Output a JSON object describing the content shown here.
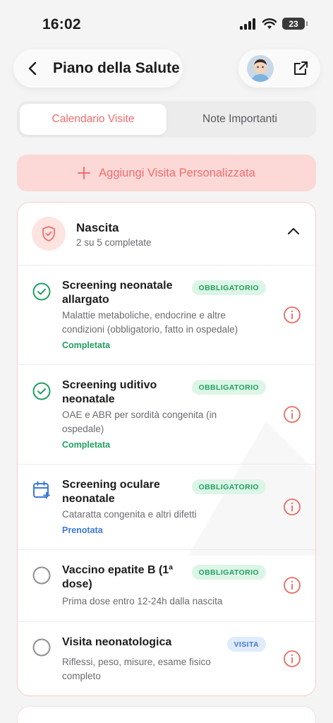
{
  "status_bar": {
    "time": "16:02",
    "battery": "23"
  },
  "header": {
    "title": "Piano della Salute"
  },
  "tabs": [
    {
      "label": "Calendario Visite",
      "active": true
    },
    {
      "label": "Note Importanti",
      "active": false
    }
  ],
  "add_button": {
    "label": "Aggiungi Visita Personalizzata"
  },
  "category": {
    "title": "Nascita",
    "subtitle": "2 su 5 completate",
    "icon": "shield-icon",
    "visits": [
      {
        "title": "Screening neonatale allargato",
        "badge": "OBBLIGATORIO",
        "description": "Malattie metaboliche, endocrine e altre condizioni (obbligatorio, fatto in ospedale)",
        "status": "Completata",
        "status_icon": "check-circle-icon"
      },
      {
        "title": "Screening uditivo neonatale",
        "badge": "OBBLIGATORIO",
        "description": "OAE e ABR per sordità congenita (in ospedale)",
        "status": "Completata",
        "status_icon": "check-circle-icon"
      },
      {
        "title": "Screening oculare neonatale",
        "badge": "OBBLIGATORIO",
        "description": "Cataratta congenita e altri difetti",
        "status": "Prenotata",
        "status_icon": "calendar-plus-icon"
      },
      {
        "title": "Vaccino epatite B (1ª dose)",
        "badge": "OBBLIGATORIO",
        "description": "Prima dose entro 12-24h dalla nascita",
        "status": "",
        "status_icon": "empty-circle-icon"
      },
      {
        "title": "Visita neonatologica",
        "badge": "VISITA",
        "description": "Riflessi, peso, misure, esame fisico completo",
        "status": "",
        "status_icon": "empty-circle-icon"
      }
    ]
  },
  "colors": {
    "accent": "#f26d6d",
    "accent_light": "#fcd9d6",
    "green": "#24a062",
    "blue": "#3d7ad8"
  }
}
